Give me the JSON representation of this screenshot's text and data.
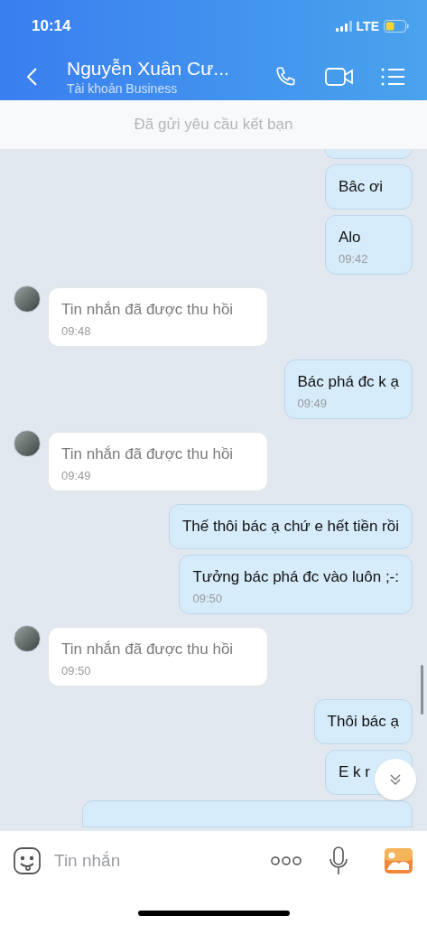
{
  "status_bar": {
    "time": "10:14",
    "network": "LTE"
  },
  "header": {
    "title": "Nguyễn Xuân Cư...",
    "subtitle": "Tài khoản Business"
  },
  "banner": "Đã gửi yêu cầu kết bạn",
  "messages": [
    {
      "kind": "fragment_top"
    },
    {
      "kind": "sent",
      "text": "Bâc ơi"
    },
    {
      "kind": "sent",
      "text": "Alo",
      "time": "09:42"
    },
    {
      "kind": "recalled",
      "text": "Tin nhắn đã được thu hồi",
      "time": "09:48"
    },
    {
      "kind": "sent",
      "text": "Bác phá đc k ạ",
      "time": "09:49"
    },
    {
      "kind": "recalled",
      "text": "Tin nhắn đã được thu hồi",
      "time": "09:49"
    },
    {
      "kind": "sent",
      "text": "Thế thôi bác ạ chứ e hết tiền rồi"
    },
    {
      "kind": "sent",
      "text": "Tưởng bác phá đc vào luôn ;-:",
      "time": "09:50"
    },
    {
      "kind": "recalled",
      "text": "Tin nhắn đã được thu hồi",
      "time": "09:50"
    },
    {
      "kind": "sent",
      "text": "Thôi bác ạ"
    },
    {
      "kind": "sent",
      "text": "E k r"
    },
    {
      "kind": "fragment_bottom"
    }
  ],
  "composer": {
    "placeholder": "Tin nhắn"
  }
}
